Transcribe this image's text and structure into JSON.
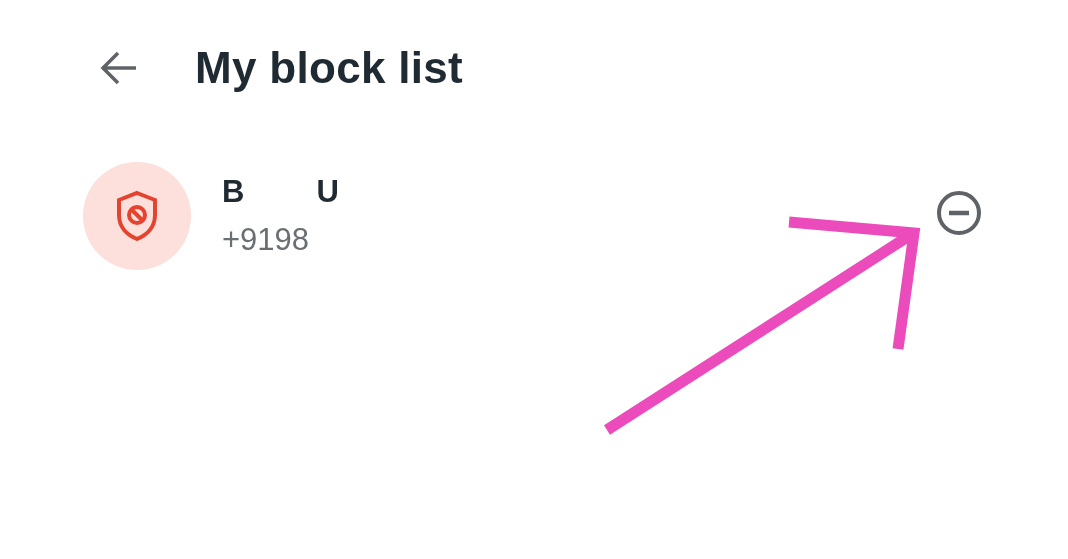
{
  "header": {
    "title": "My block list"
  },
  "contacts": [
    {
      "name_parts": [
        "B",
        "U"
      ],
      "number": "+9198"
    }
  ],
  "annotation": {
    "kind": "arrow"
  }
}
